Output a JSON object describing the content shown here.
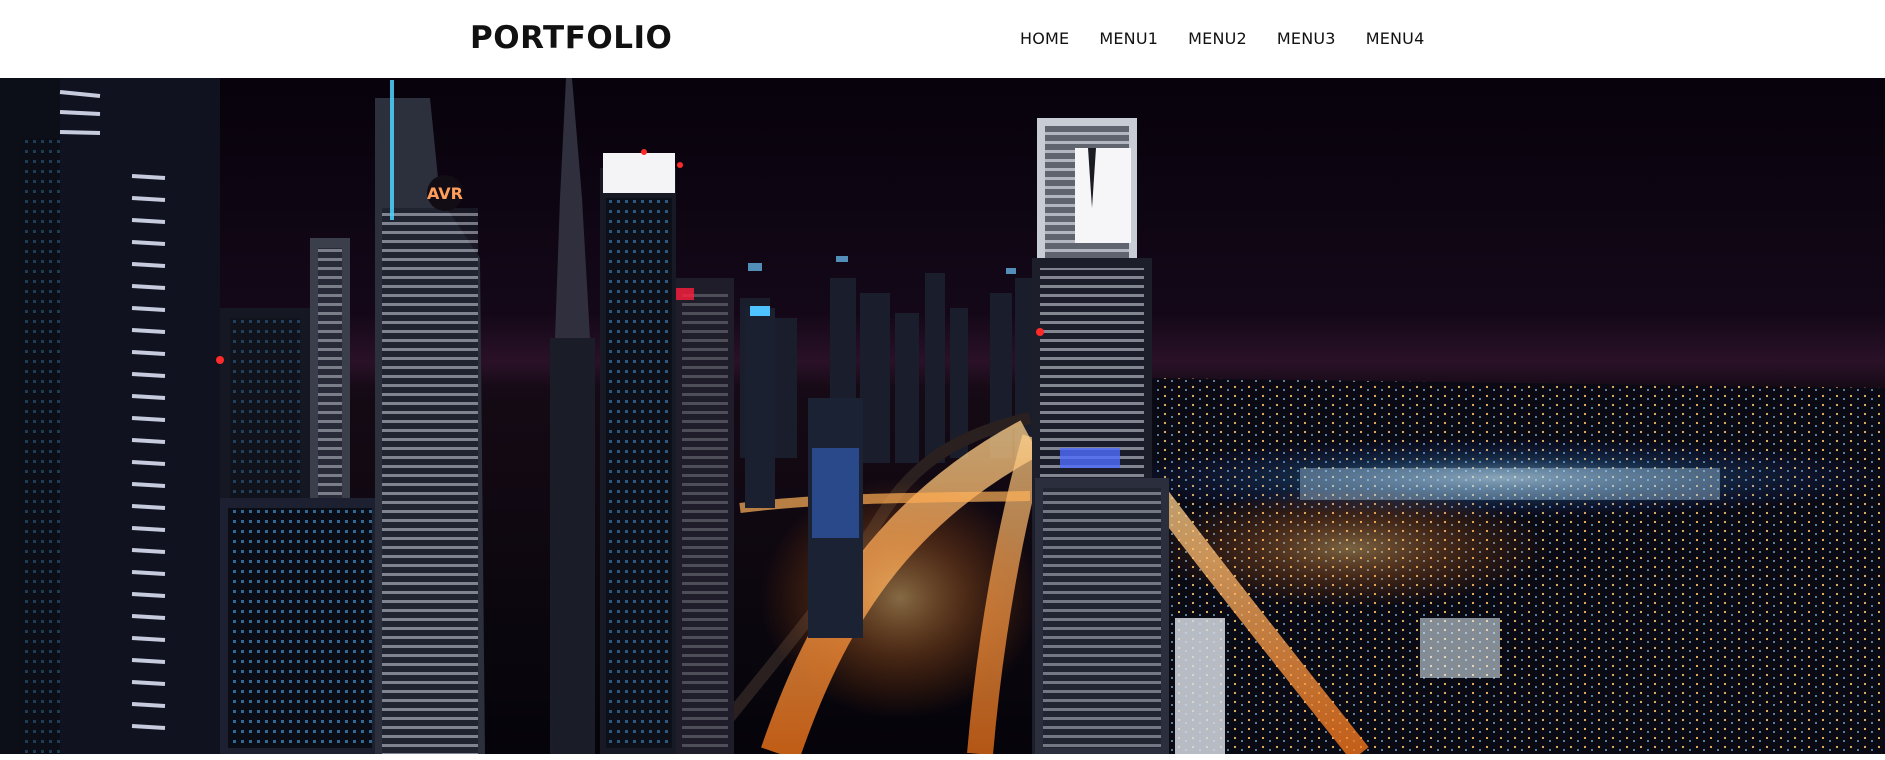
{
  "header": {
    "logo": "PORTFOLIO",
    "nav": [
      "HOME",
      "MENU1",
      "MENU2",
      "MENU3",
      "MENU4"
    ]
  },
  "hero": {
    "image_description_icon": "city-skyline-night-image",
    "building_sign": "AVR"
  },
  "colors": {
    "header_bg": "#ffffff",
    "text": "#111111",
    "sky": "#07030a",
    "city_light_warm": "#ffb347",
    "city_light_cool": "#6fc8ff"
  }
}
